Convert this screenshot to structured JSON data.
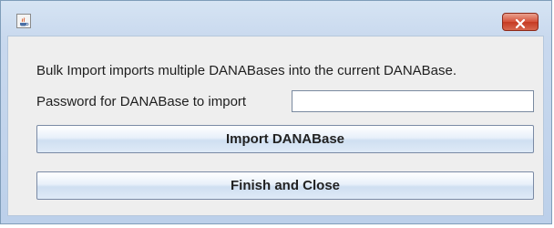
{
  "window": {
    "title": "",
    "app_icon": "java-cup-icon",
    "close_icon": "close-icon"
  },
  "dialog": {
    "info_text": "Bulk Import imports multiple DANABases into the current DANABase.",
    "password_label": "Password for DANABase to import",
    "password_value": "",
    "password_placeholder": "",
    "import_button_label": "Import DANABase",
    "finish_button_label": "Finish and Close"
  },
  "colors": {
    "close_button": "#d5513a",
    "window_frame": "#c9d9ee",
    "content_bg": "#eeeeee"
  }
}
